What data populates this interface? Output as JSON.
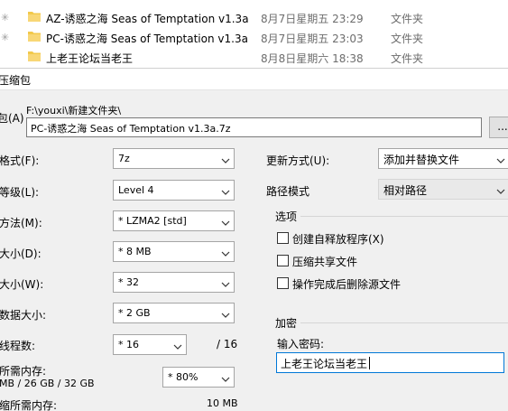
{
  "files": [
    {
      "name": "AZ-诱惑之海 Seas of Temptation v1.3a",
      "date": "8月7日星期五 23:29",
      "type": "文件夹"
    },
    {
      "name": "PC-诱惑之海 Seas of Temptation v1.3a",
      "date": "8月7日星期五 23:03",
      "type": "文件夹"
    },
    {
      "name": "上老王论坛当老王",
      "date": "8月8日星期六 18:38",
      "type": "文件夹"
    }
  ],
  "dialog": {
    "title": "压缩包",
    "archive_label": "包(A)",
    "path": "F:\\youxi\\新建文件夹\\",
    "archive_name": "PC-诱惑之海 Seas of Temptation v1.3a.7z",
    "browse_label": "..."
  },
  "left": {
    "format_label": "格式(F):",
    "format_value": "7z",
    "level_label": "等级(L):",
    "level_value": "Level 4",
    "method_label": "方法(M):",
    "method_value": "* LZMA2 [std]",
    "dict_label": "大小(D):",
    "dict_value": "* 8 MB",
    "word_label": "大小(W):",
    "word_value": "* 32",
    "solid_label": "数据大小:",
    "solid_value": "* 2 GB",
    "threads_label": "线程数:",
    "threads_value": "* 16",
    "threads_max": "/ 16",
    "mem_label": "所需内存:",
    "mem_detail": "MB / 26 GB / 32 GB",
    "mem_value": "* 80%",
    "decomp_label": "缩所需内存:",
    "decomp_value": "10 MB"
  },
  "right": {
    "update_label": "更新方式(U):",
    "update_value": "添加并替换文件",
    "pathmode_label": "路径模式",
    "pathmode_value": "相对路径",
    "options_title": "选项",
    "opt_sfx": "创建自释放程序(X)",
    "opt_shared": "压缩共享文件",
    "opt_delete": "操作完成后删除源文件",
    "encrypt_title": "加密",
    "password_label": "输入密码:",
    "password_value": "上老王论坛当老王"
  }
}
